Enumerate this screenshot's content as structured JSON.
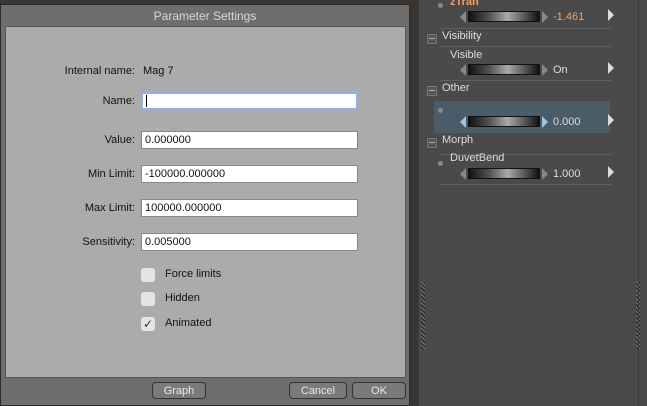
{
  "dialog": {
    "title": "Parameter Settings",
    "internal_name_label": "Internal name:",
    "internal_name_value": "Mag 7",
    "fields": [
      {
        "label": "Name:",
        "value": ""
      },
      {
        "label": "Value:",
        "value": "0.000000"
      },
      {
        "label": "Min Limit:",
        "value": "-100000.000000"
      },
      {
        "label": "Max Limit:",
        "value": "100000.000000"
      },
      {
        "label": "Sensitivity:",
        "value": "0.005000"
      }
    ],
    "checkboxes": [
      {
        "label": "Force limits",
        "checked": false
      },
      {
        "label": "Hidden",
        "checked": false
      },
      {
        "label": "Animated",
        "checked": true,
        "mark": "✓"
      }
    ],
    "buttons": {
      "graph": "Graph",
      "cancel": "Cancel",
      "ok": "OK"
    }
  },
  "panel": {
    "ztran": {
      "label": "zTran",
      "value": "-1.461",
      "color": "#f0a060"
    },
    "visibility": {
      "header": "Visibility",
      "minus": "–",
      "param": "Visible",
      "value": "On"
    },
    "other": {
      "header": "Other",
      "minus": "–",
      "value": "0.000",
      "highlight": "#4a5c68"
    },
    "morph": {
      "header": "Morph",
      "minus": "–",
      "param": "DuvetBend",
      "value": "1.000"
    }
  }
}
